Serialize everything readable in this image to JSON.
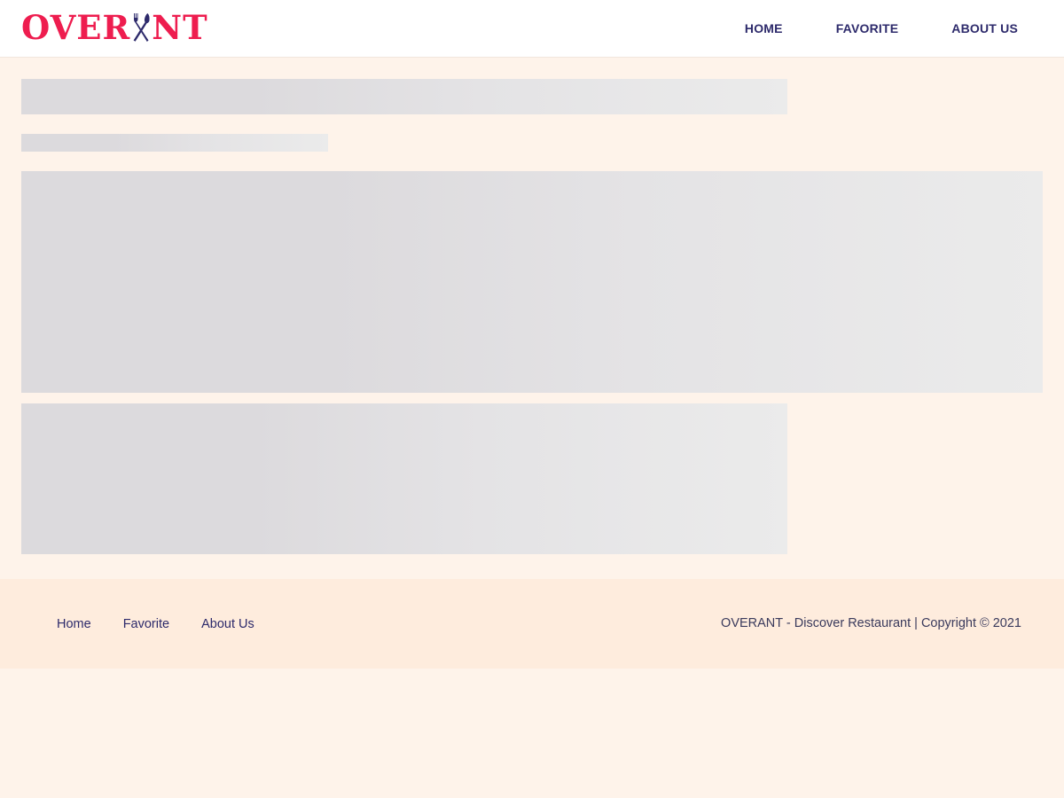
{
  "header": {
    "logo": {
      "text_before": "OVER",
      "text_after": "NT",
      "icon": "fork-knife-icon",
      "color": "#ee1d4f"
    },
    "nav": [
      {
        "label": "HOME"
      },
      {
        "label": "FAVORITE"
      },
      {
        "label": "ABOUT US"
      }
    ]
  },
  "main": {
    "state": "loading-skeleton"
  },
  "footer": {
    "links": [
      {
        "label": "Home"
      },
      {
        "label": "Favorite"
      },
      {
        "label": "About Us"
      }
    ],
    "copyright": "OVERANT - Discover Restaurant | Copyright © 2021"
  },
  "colors": {
    "brand": "#ee1d4f",
    "nav_text": "#2d2a6b",
    "page_background": "#fef3ea",
    "footer_background": "#feecdd",
    "skeleton": "#dcdadd"
  }
}
